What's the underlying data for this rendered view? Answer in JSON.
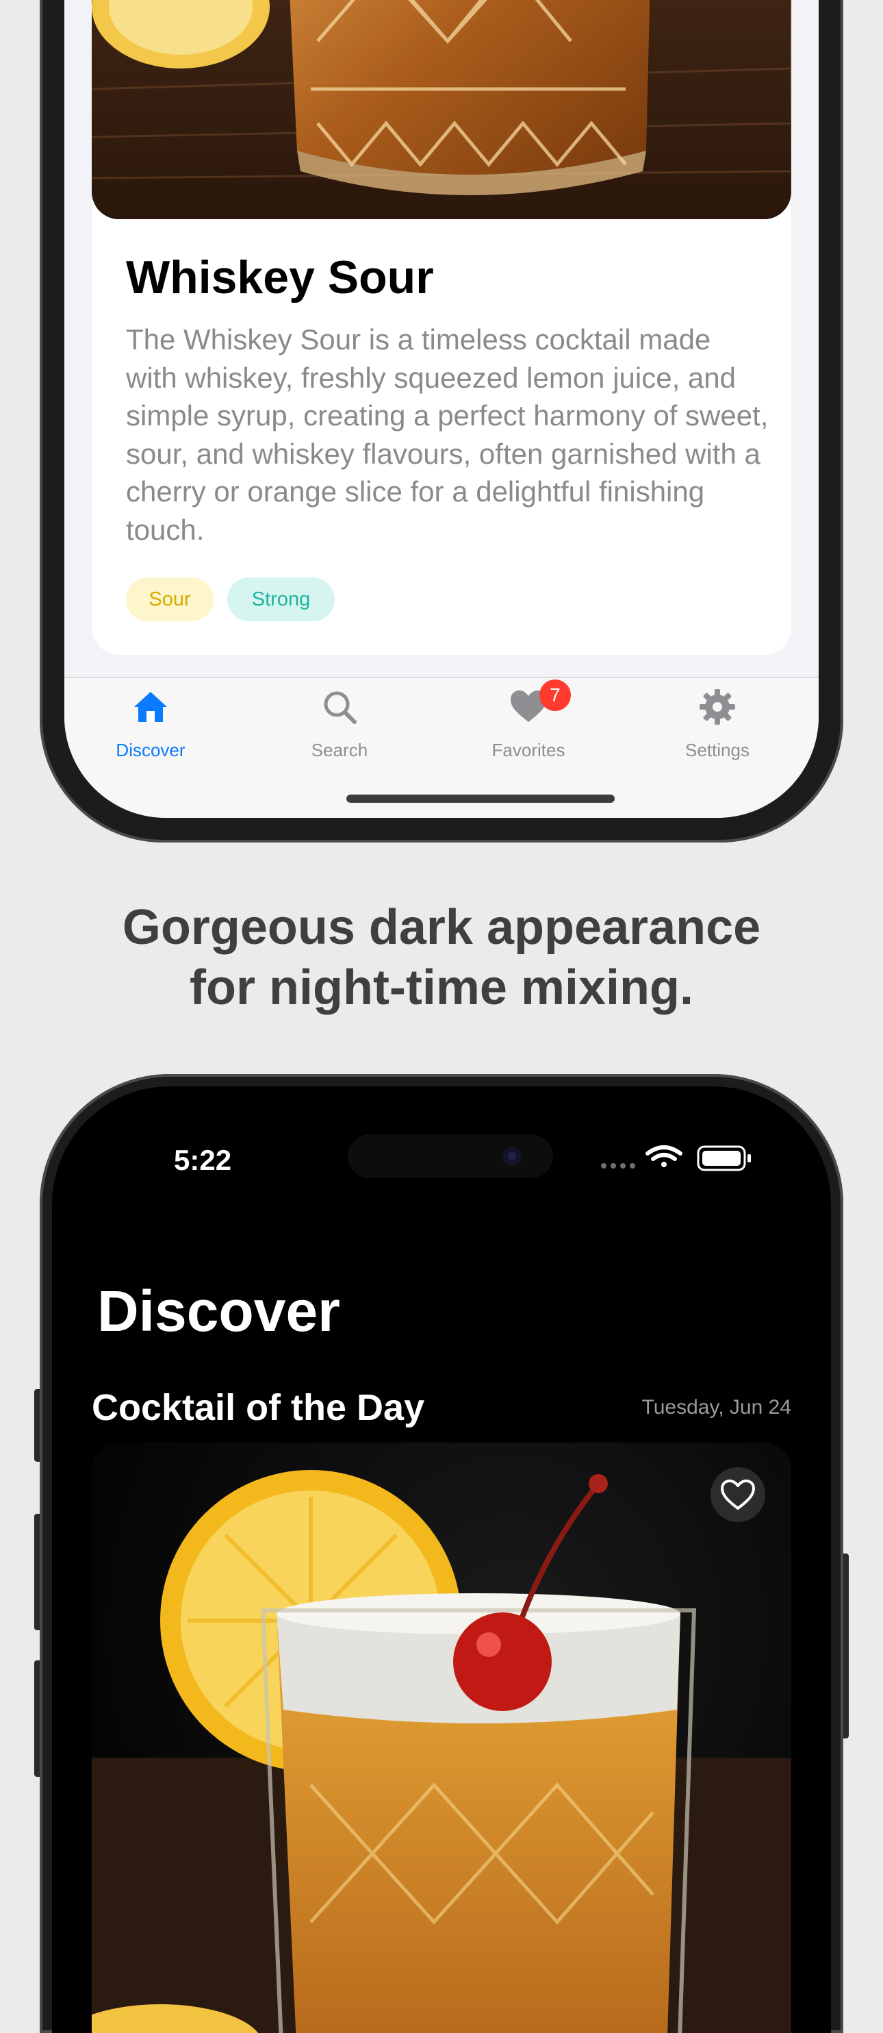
{
  "light_screen": {
    "cocktail": {
      "name": "Whiskey Sour",
      "description": "The Whiskey Sour is a timeless cocktail made with whiskey, freshly squeezed lemon juice, and simple syrup, creating a perfect harmony of sweet, sour, and whiskey flavours, often garnished with a cherry or orange slice for a delightful finishing touch.",
      "tags": [
        "Sour",
        "Strong"
      ]
    },
    "tab_bar": {
      "items": [
        {
          "label": "Discover",
          "icon": "house-icon",
          "active": true
        },
        {
          "label": "Search",
          "icon": "magnifier-icon",
          "active": false
        },
        {
          "label": "Favorites",
          "icon": "heart-icon",
          "active": false,
          "badge": "7"
        },
        {
          "label": "Settings",
          "icon": "gear-icon",
          "active": false
        }
      ]
    }
  },
  "headline": {
    "line1": "Gorgeous dark appearance",
    "line2": "for night-time mixing."
  },
  "dark_screen": {
    "status_bar": {
      "time": "5:22"
    },
    "page_title": "Discover",
    "section_title": "Cocktail of the Day",
    "date": "Tuesday, Jun 24"
  },
  "colors": {
    "accent": "#0a7aff",
    "badge": "#ff3b30",
    "tag_sour_bg": "#fdf5cc",
    "tag_sour_text": "#d4ad00",
    "tag_strong_bg": "#d7f5f0",
    "tag_strong_text": "#1fb5a0"
  }
}
